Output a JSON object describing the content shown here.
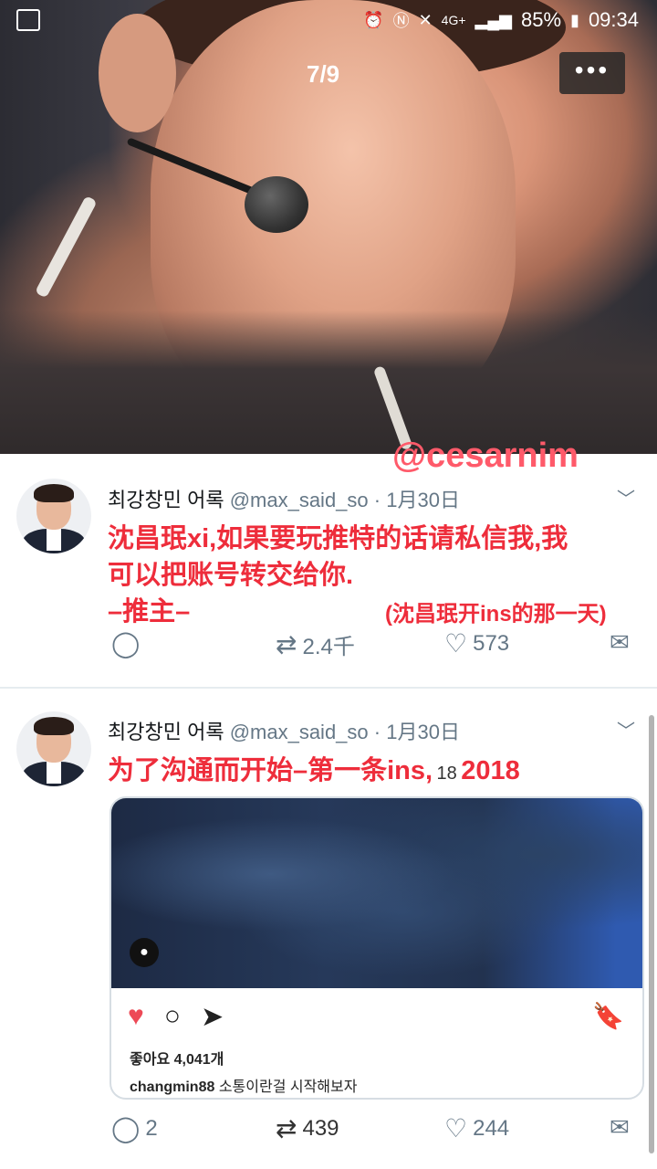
{
  "status_bar": {
    "network": "4G+",
    "battery": "85%",
    "time": "09:34"
  },
  "viewer": {
    "counter": "7/9",
    "more_label": "•••"
  },
  "watermark": "@cesarnim",
  "tweets": [
    {
      "name": "최강창민 어록",
      "handle": "@max_said_so",
      "date": "1月30日",
      "text_line1": "沈昌珉xi,如果要玩推特的话请私信我,我",
      "text_line2": "可以把账号转交给你.",
      "signature": "–推主–",
      "annotation": "(沈昌珉开ins的那一天)",
      "retweets": "2.4千",
      "likes": "573"
    },
    {
      "name": "최강창민 어록",
      "handle": "@max_said_so",
      "date": "1月30日",
      "text": "为了沟通而开始–第一条ins,",
      "text_small": "18",
      "text_year": "2018",
      "replies": "2",
      "retweets": "439",
      "likes": "244",
      "instagram": {
        "likes_text": "좋아요 4,041개",
        "caption_user": "changmin88",
        "caption_text": "소통이란걸 시작해보자"
      }
    }
  ]
}
